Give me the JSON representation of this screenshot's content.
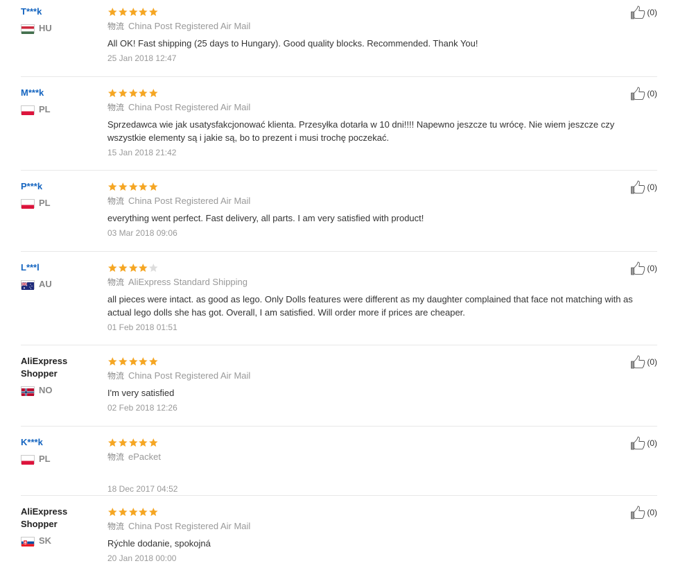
{
  "colors": {
    "star": "#f5a623",
    "star_empty": "#dddddd",
    "username_link": "#1565c0"
  },
  "reviews": [
    {
      "user": "T***k",
      "linked": true,
      "country": "HU",
      "rating": 5,
      "shipping_label": "物流",
      "shipping": "China Post Registered Air Mail",
      "comment": "All OK! Fast shipping (25 days to Hungary). Good quality blocks. Recommended. Thank You!",
      "date": "25 Jan 2018 12:47",
      "helpful": "(0)"
    },
    {
      "user": "M***k",
      "linked": true,
      "country": "PL",
      "rating": 5,
      "shipping_label": "物流",
      "shipping": "China Post Registered Air Mail",
      "comment": "Sprzedawca wie jak usatysfakcjonować klienta. Przesyłka dotarła w 10 dni!!!! Napewno jeszcze tu wrócę. Nie wiem jeszcze czy wszystkie elementy są i jakie są, bo to prezent i musi trochę poczekać.",
      "date": "15 Jan 2018 21:42",
      "helpful": "(0)"
    },
    {
      "user": "P***k",
      "linked": true,
      "country": "PL",
      "rating": 5,
      "shipping_label": "物流",
      "shipping": "China Post Registered Air Mail",
      "comment": "everything went perfect. Fast delivery, all parts. I am very satisfied with product!",
      "date": "03 Mar 2018 09:06",
      "helpful": "(0)"
    },
    {
      "user": "L***l",
      "linked": true,
      "country": "AU",
      "rating": 4,
      "shipping_label": "物流",
      "shipping": "AliExpress Standard Shipping",
      "comment": "all pieces were intact. as good as lego. Only Dolls features were different as my daughter complained that face not matching with as actual lego dolls she has got. Overall, I am satisfied. Will order more if prices are cheaper.",
      "date": "01 Feb 2018 01:51",
      "helpful": "(0)"
    },
    {
      "user": "AliExpress Shopper",
      "linked": false,
      "country": "NO",
      "rating": 5,
      "shipping_label": "物流",
      "shipping": "China Post Registered Air Mail",
      "comment": "I'm very satisfied",
      "date": "02 Feb 2018 12:26",
      "helpful": "(0)"
    },
    {
      "user": "K***k",
      "linked": true,
      "country": "PL",
      "rating": 5,
      "shipping_label": "物流",
      "shipping": "ePacket",
      "comment": "",
      "date": "18 Dec 2017 04:52",
      "helpful": "(0)"
    },
    {
      "user": "AliExpress Shopper",
      "linked": false,
      "country": "SK",
      "rating": 5,
      "shipping_label": "物流",
      "shipping": "China Post Registered Air Mail",
      "comment": "Rýchle dodanie, spokojná",
      "date": "20 Jan 2018 00:00",
      "helpful": "(0)"
    }
  ]
}
